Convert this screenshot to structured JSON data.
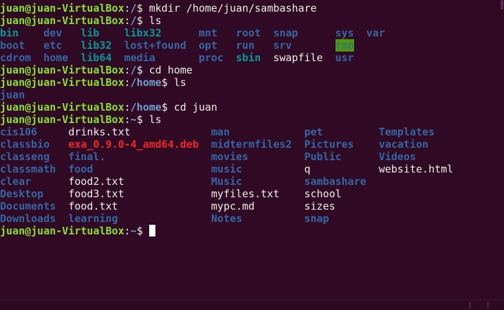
{
  "terminal": {
    "colors": {
      "background": "#300a24",
      "prompt_user": "#8ae234",
      "prompt_path": "#729fcf",
      "directory": "#3465a4",
      "symlink": "#06989a",
      "archive": "#ef2929",
      "plain": "#eeeeec",
      "sticky_bg": "#4e9a06"
    },
    "lines": [
      {
        "type": "text",
        "segments": [
          {
            "t": "juan@juan-VirtualBox",
            "c": "user"
          },
          {
            "t": ":",
            "c": "plain"
          },
          {
            "t": "/",
            "c": "path"
          },
          {
            "t": "$ mkdir /home/juan/sambashare",
            "c": "plain"
          }
        ]
      },
      {
        "type": "text",
        "segments": [
          {
            "t": "juan@juan-VirtualBox",
            "c": "user"
          },
          {
            "t": ":",
            "c": "plain"
          },
          {
            "t": "/",
            "c": "path"
          },
          {
            "t": "$ ls",
            "c": "plain"
          }
        ]
      },
      {
        "type": "grid",
        "cells": [
          {
            "t": "bin",
            "c": "link",
            "col": 0
          },
          {
            "t": "dev",
            "c": "dir",
            "col": 7
          },
          {
            "t": "lib",
            "c": "link",
            "col": 13
          },
          {
            "t": "libx32",
            "c": "link",
            "col": 20
          },
          {
            "t": "mnt",
            "c": "dir",
            "col": 32
          },
          {
            "t": "root",
            "c": "dir",
            "col": 38
          },
          {
            "t": "snap",
            "c": "dir",
            "col": 44
          },
          {
            "t": "sys",
            "c": "dir",
            "col": 54
          },
          {
            "t": "var",
            "c": "dir",
            "col": 59
          }
        ]
      },
      {
        "type": "grid",
        "cells": [
          {
            "t": "boot",
            "c": "dir",
            "col": 0
          },
          {
            "t": "etc",
            "c": "dir",
            "col": 7
          },
          {
            "t": "lib32",
            "c": "link",
            "col": 13
          },
          {
            "t": "lost+found",
            "c": "dir",
            "col": 20
          },
          {
            "t": "opt",
            "c": "dir",
            "col": 32
          },
          {
            "t": "run",
            "c": "dir",
            "col": 38
          },
          {
            "t": "srv",
            "c": "dir",
            "col": 44
          },
          {
            "t": "tmp",
            "c": "sticky",
            "col": 54
          }
        ]
      },
      {
        "type": "grid",
        "cells": [
          {
            "t": "cdrom",
            "c": "dir",
            "col": 0
          },
          {
            "t": "home",
            "c": "dir",
            "col": 7
          },
          {
            "t": "lib64",
            "c": "link",
            "col": 13
          },
          {
            "t": "media",
            "c": "dir",
            "col": 20
          },
          {
            "t": "proc",
            "c": "dir",
            "col": 32
          },
          {
            "t": "sbin",
            "c": "link",
            "col": 38
          },
          {
            "t": "swapfile",
            "c": "file",
            "col": 44
          },
          {
            "t": "usr",
            "c": "dir",
            "col": 54
          }
        ]
      },
      {
        "type": "text",
        "segments": [
          {
            "t": "juan@juan-VirtualBox",
            "c": "user"
          },
          {
            "t": ":",
            "c": "plain"
          },
          {
            "t": "/",
            "c": "path"
          },
          {
            "t": "$ cd home",
            "c": "plain"
          }
        ]
      },
      {
        "type": "text",
        "segments": [
          {
            "t": "juan@juan-VirtualBox",
            "c": "user"
          },
          {
            "t": ":",
            "c": "plain"
          },
          {
            "t": "/home",
            "c": "path"
          },
          {
            "t": "$ ls",
            "c": "plain"
          }
        ]
      },
      {
        "type": "grid",
        "cells": [
          {
            "t": "juan",
            "c": "dir",
            "col": 0
          }
        ]
      },
      {
        "type": "text",
        "segments": [
          {
            "t": "juan@juan-VirtualBox",
            "c": "user"
          },
          {
            "t": ":",
            "c": "plain"
          },
          {
            "t": "/home",
            "c": "path"
          },
          {
            "t": "$ cd juan",
            "c": "plain"
          }
        ]
      },
      {
        "type": "text",
        "segments": [
          {
            "t": "juan@juan-VirtualBox",
            "c": "user"
          },
          {
            "t": ":",
            "c": "plain"
          },
          {
            "t": "~",
            "c": "path"
          },
          {
            "t": "$ ls",
            "c": "plain"
          }
        ]
      },
      {
        "type": "grid",
        "cells": [
          {
            "t": "cis106",
            "c": "dir",
            "col": 0
          },
          {
            "t": "drinks.txt",
            "c": "file",
            "col": 11
          },
          {
            "t": "man",
            "c": "dir",
            "col": 34
          },
          {
            "t": "pet",
            "c": "dir",
            "col": 49
          },
          {
            "t": "Templates",
            "c": "dir",
            "col": 61
          }
        ]
      },
      {
        "type": "grid",
        "cells": [
          {
            "t": "classbio",
            "c": "dir",
            "col": 0
          },
          {
            "t": "exa_0.9.0-4_amd64.deb",
            "c": "archive",
            "col": 11
          },
          {
            "t": "midtermfiles2",
            "c": "dir",
            "col": 34
          },
          {
            "t": "Pictures",
            "c": "dir",
            "col": 49
          },
          {
            "t": "vacation",
            "c": "dir",
            "col": 61
          }
        ]
      },
      {
        "type": "grid",
        "cells": [
          {
            "t": "classeng",
            "c": "dir",
            "col": 0
          },
          {
            "t": "final.",
            "c": "dir",
            "col": 11
          },
          {
            "t": "movies",
            "c": "dir",
            "col": 34
          },
          {
            "t": "Public",
            "c": "dir",
            "col": 49
          },
          {
            "t": "Videos",
            "c": "dir",
            "col": 61
          }
        ]
      },
      {
        "type": "grid",
        "cells": [
          {
            "t": "classmath",
            "c": "dir",
            "col": 0
          },
          {
            "t": "food",
            "c": "dir",
            "col": 11
          },
          {
            "t": "music",
            "c": "dir",
            "col": 34
          },
          {
            "t": "q",
            "c": "file",
            "col": 49
          },
          {
            "t": "website.html",
            "c": "file",
            "col": 61
          }
        ]
      },
      {
        "type": "grid",
        "cells": [
          {
            "t": "clear",
            "c": "dir",
            "col": 0
          },
          {
            "t": "food2.txt",
            "c": "file",
            "col": 11
          },
          {
            "t": "Music",
            "c": "dir",
            "col": 34
          },
          {
            "t": "sambashare",
            "c": "dir",
            "col": 49
          }
        ]
      },
      {
        "type": "grid",
        "cells": [
          {
            "t": "Desktop",
            "c": "dir",
            "col": 0
          },
          {
            "t": "food3.txt",
            "c": "file",
            "col": 11
          },
          {
            "t": "myfiles.txt",
            "c": "file",
            "col": 34
          },
          {
            "t": "school",
            "c": "file",
            "col": 49
          }
        ]
      },
      {
        "type": "grid",
        "cells": [
          {
            "t": "Documents",
            "c": "dir",
            "col": 0
          },
          {
            "t": "food.txt",
            "c": "file",
            "col": 11
          },
          {
            "t": "mypc.md",
            "c": "file",
            "col": 34
          },
          {
            "t": "sizes",
            "c": "file",
            "col": 49
          }
        ]
      },
      {
        "type": "grid",
        "cells": [
          {
            "t": "Downloads",
            "c": "dir",
            "col": 0
          },
          {
            "t": "learning",
            "c": "dir",
            "col": 11
          },
          {
            "t": "Notes",
            "c": "dir",
            "col": 34
          },
          {
            "t": "snap",
            "c": "dir",
            "col": 49
          }
        ]
      },
      {
        "type": "prompt",
        "segments": [
          {
            "t": "juan@juan-VirtualBox",
            "c": "user"
          },
          {
            "t": ":",
            "c": "plain"
          },
          {
            "t": "~",
            "c": "path"
          },
          {
            "t": "$ ",
            "c": "plain"
          }
        ]
      }
    ]
  }
}
